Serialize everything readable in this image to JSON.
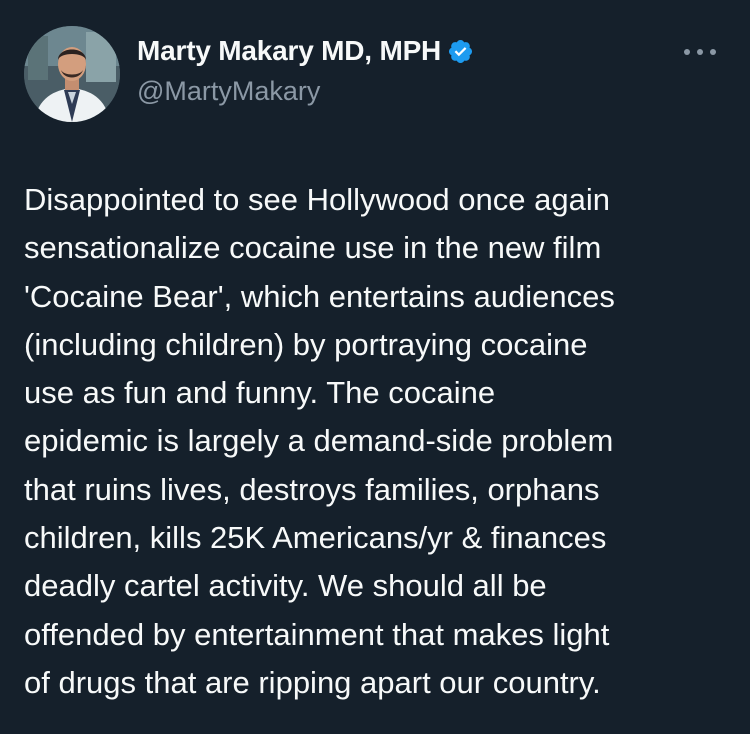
{
  "author": {
    "display_name": "Marty Makary MD, MPH",
    "handle": "@MartyMakary",
    "verified": true,
    "avatar_icon": "profile-photo",
    "verified_icon": "verified-badge-icon",
    "more_icon": "more-options-icon"
  },
  "tweet": {
    "lines": [
      "Disappointed to see Hollywood once again",
      "sensationalize cocaine use in the new film",
      "'Cocaine Bear', which entertains audiences",
      "(including children) by portraying cocaine",
      "use as fun and funny. The cocaine",
      "epidemic is largely a demand-side problem",
      "that ruins lives, destroys families, orphans",
      "children, kills 25K Americans/yr & finances",
      "deadly cartel activity. We should all be",
      "offended by entertainment that makes light",
      "of drugs that are ripping apart our country."
    ]
  },
  "colors": {
    "background": "#15202b",
    "text_primary": "#f7f9f9",
    "text_secondary": "#8b98a5",
    "verified_blue": "#1d9bf0"
  }
}
